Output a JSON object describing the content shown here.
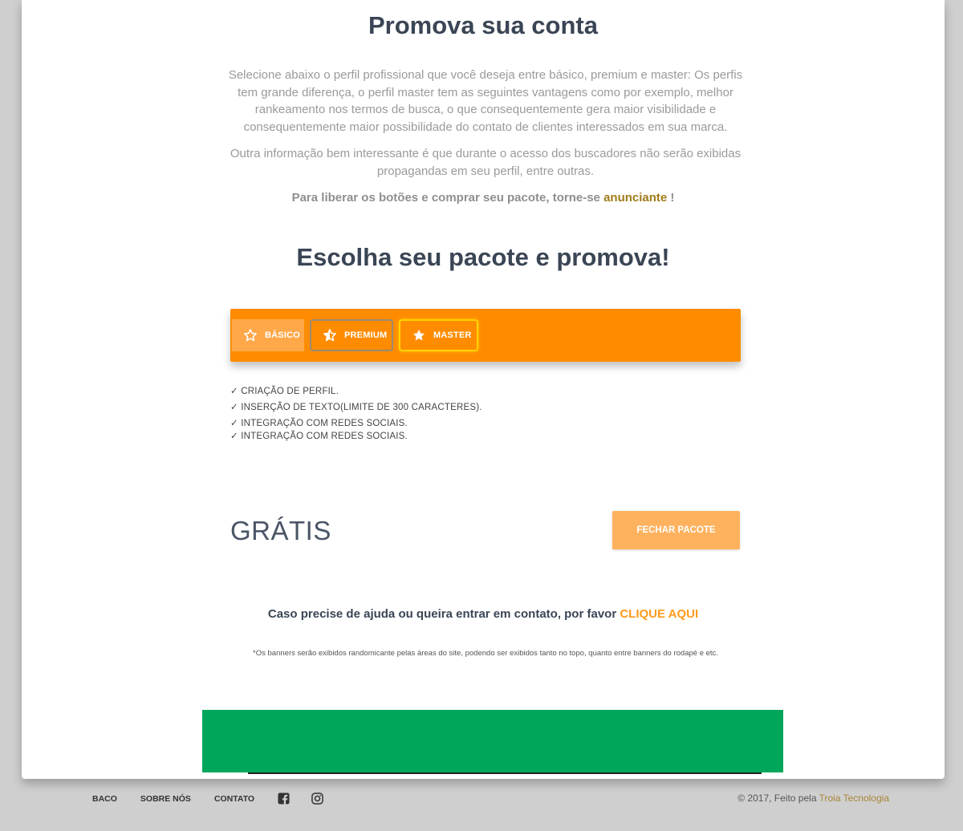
{
  "main": {
    "title": "Promova sua conta",
    "paragraph1": "Selecione abaixo o perfil profissional que você deseja entre básico, premium e master: Os perfis tem grande diferença, o perfil master tem as seguintes vantagens como por exemplo, melhor rankeamento nos termos de busca, o que consequentemente gera maior visibilidade e consequentemente maior possibilidade do contato de clientes interessados em sua marca.",
    "paragraph2": "Outra informação bem interessante é que durante o acesso dos buscadores não serão exibidas propagandas em seu perfil, entre outras.",
    "unlock_text": "Para liberar os botões e comprar seu pacote, torne-se",
    "unlock_link": "anunciante",
    "unlock_suffix": " !",
    "subtitle": "Escolha seu pacote e promova!"
  },
  "tabs": [
    {
      "label": "BÁSICO",
      "icon": "star-outline-icon"
    },
    {
      "label": "PREMIUM",
      "icon": "star-half-icon"
    },
    {
      "label": "MASTER",
      "icon": "star-filled-icon"
    }
  ],
  "features": [
    "✓ CRIAÇÃO DE PERFIL.",
    "✓ INSERÇÃO DE TEXTO(LIMITE DE 300 CARACTERES).",
    "✓ INTEGRAÇÃO COM REDES SOCIAIS.",
    "✓ INTEGRAÇÃO COM REDES SOCIAIS."
  ],
  "package": {
    "price": "GRÁTIS",
    "close_button": "FECHAR PACOTE"
  },
  "help": {
    "text": "Caso precise de ajuda ou queira entrar em contato, por favor ",
    "link": "CLIQUE AQUI"
  },
  "note": "*Os banners serão exibidos randomicante pelas áreas do site, podendo ser exibidos tanto no topo, quanto entre banners do rodapé e etc.",
  "footer": {
    "nav": [
      "BACO",
      "SOBRE NÓS",
      "CONTATO"
    ],
    "social_icons": [
      "facebook-icon",
      "instagram-icon"
    ],
    "copyright": "© 2017, Feito pela ",
    "brand": "Troia Tecnologia"
  },
  "colors": {
    "accent": "#ff8c00",
    "banner": "#00a65a",
    "heading": "#3a4555"
  }
}
